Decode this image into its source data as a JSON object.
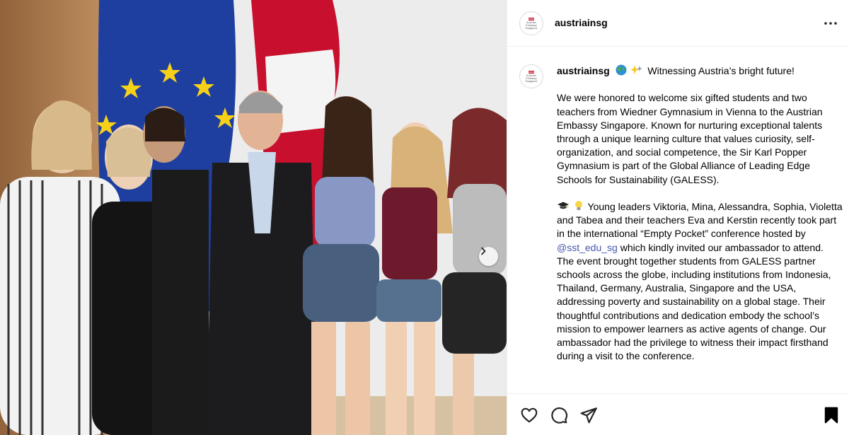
{
  "post": {
    "username": "austriainsg",
    "avatar": {
      "lines": [
        "Austrian",
        "Embassy",
        "Singapore"
      ],
      "flag_colors": [
        "#c8102e",
        "#ffffff",
        "#c8102e"
      ]
    },
    "caption": {
      "username": "austriainsg",
      "headline": "Witnessing Austria’s bright future!",
      "headline_icons": [
        "globe-emoji",
        "sparkle-emoji"
      ],
      "paragraph1": "We were honored to welcome six gifted students and two teachers from Wiedner Gymnasium in Vienna to the Austrian Embassy Singapore. Known for nurturing exceptional talents through a unique learning culture that values curiosity, self-organization, and social competence, the Sir Karl Popper Gymnasium is part of the Global Alliance of Leading Edge Schools for Sustainability (GALESS).",
      "paragraph2_icons": [
        "graduation-cap-emoji",
        "light-bulb-emoji"
      ],
      "paragraph2_before": "Young leaders Viktoria, Mina, Alessandra, Sophia, Violetta and Tabea and their teachers Eva and Kerstin recently took part in the international “Empty Pocket” conference hosted by",
      "mention": "@sst_edu_sg",
      "paragraph2_after": "which kindly invited our ambassador to attend. The event brought together students from GALESS partner schools across the globe, including institutions from Indonesia, Thailand, Germany, Australia, Singapore and the USA, addressing poverty and sustainability on a global stage. Their thoughtful contributions and dedication embody the school’s mission to empower learners as active agents of change. Our ambassador had the privilege to witness their impact firsthand during a visit to the conference."
    },
    "actions": [
      "heart-icon",
      "comment-icon",
      "share-icon",
      "bookmark-icon"
    ],
    "carousel": {
      "next_icon": "chevron-right-icon"
    }
  },
  "colors": {
    "mention": "#4258ad",
    "eu_blue": "#1f3fa0",
    "eu_star": "#f7d117",
    "austria_red": "#c8102e"
  }
}
